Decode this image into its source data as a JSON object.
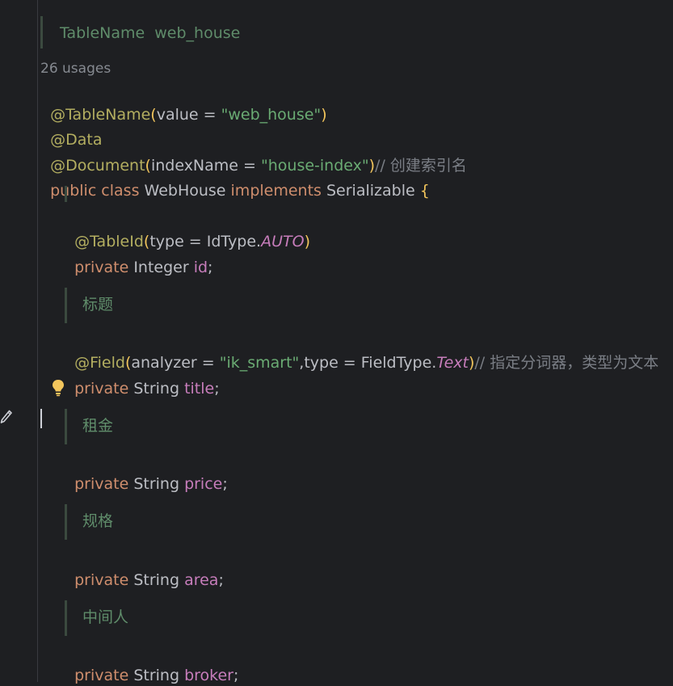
{
  "editor": {
    "doc_tablename": "TableName  web_house",
    "usages": "26 usages",
    "line_tablename": {
      "ann": "@TableName",
      "p1": "(value = ",
      "str": "\"web_house\"",
      "p2": ")"
    },
    "line_data": "@Data",
    "line_document": {
      "ann": "@Document",
      "p1": "(indexName = ",
      "str": "\"house-index\"",
      "p2": ")",
      "comment": "// 创建索引名"
    },
    "line_class": {
      "kw": "public class ",
      "name": "WebHouse ",
      "kw2": "implements ",
      "iface": "Serializable ",
      "brace": "{"
    },
    "line_tableid": {
      "ann": "@TableId",
      "p1": "(type = IdType.",
      "const": "AUTO",
      "p2": ")"
    },
    "line_id": {
      "kw": "private ",
      "type": "Integer ",
      "field": "id",
      "semi": ";"
    },
    "doc_title": "标题",
    "line_field": {
      "ann": "@Field",
      "p1": "(analyzer = ",
      "str": "\"ik_smart\"",
      "p2": ",type = FieldType.",
      "const": "Text",
      "p3": ")",
      "comment": "// 指定分词器，类型为文本"
    },
    "line_title": {
      "kw": "private ",
      "type": "String ",
      "field": "title",
      "semi": ";"
    },
    "doc_rent": "租金",
    "line_price": {
      "kw": "private ",
      "type": "String ",
      "field": "price",
      "semi": ";"
    },
    "doc_spec": "规格",
    "line_area": {
      "kw": "private ",
      "type": "String ",
      "field": "area",
      "semi": ";"
    },
    "doc_broker": "中间人",
    "line_broker": {
      "kw": "private ",
      "type": "String ",
      "field": "broker",
      "semi": ";"
    }
  },
  "colors": {
    "background": "#1e1f22",
    "annotation": "#b3ae60",
    "keyword": "#cf8e6d",
    "string": "#6aab73",
    "field": "#c77dbb",
    "doc": "#5f8c6a"
  },
  "icons": [
    "pencil-icon",
    "lightbulb-icon"
  ]
}
